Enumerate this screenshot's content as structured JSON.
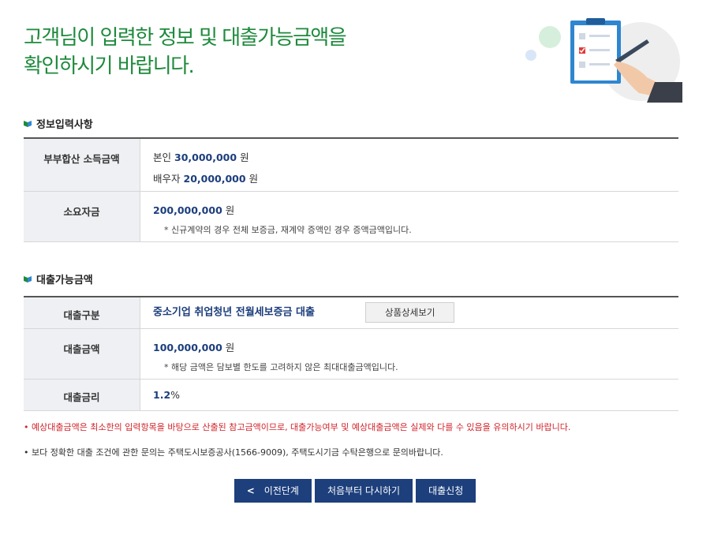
{
  "page": {
    "title_line1": "고객님이 입력한 정보 및 대출가능금액을",
    "title_line2": "확인하시기 바랍니다."
  },
  "colors": {
    "accent_green": "#1e8a3c",
    "navy": "#1d3f7c",
    "red": "#d0232a",
    "header_bg": "#eef0f3"
  },
  "input_section": {
    "heading": "정보입력사항",
    "heading_icon": "book-icon",
    "rows": {
      "income": {
        "label": "부부합산 소득금액",
        "self_label": "본인",
        "self_amount": "30,000,000",
        "self_unit": "원",
        "spouse_label": "배우자",
        "spouse_amount": "20,000,000",
        "spouse_unit": "원"
      },
      "required_funds": {
        "label": "소요자금",
        "amount": "200,000,000",
        "unit": "원",
        "note": "* 신규계약의 경우 전체 보증금, 재계약 증액인 경우 증액금액입니다."
      }
    }
  },
  "loan_section": {
    "heading": "대출가능금액",
    "heading_icon": "book-icon",
    "rows": {
      "type": {
        "label": "대출구분",
        "value": "중소기업 취업청년 전월세보증금 대출",
        "detail_button": "상품상세보기"
      },
      "amount": {
        "label": "대출금액",
        "value": "100,000,000",
        "unit": "원",
        "note": "* 해당 금액은 담보별 한도를 고려하지 않은 최대대출금액입니다."
      },
      "rate": {
        "label": "대출금리",
        "value": "1.2",
        "unit": "%"
      }
    }
  },
  "notices": [
    "• 예상대출금액은 최소한의 입력항목을 바탕으로 산출된 참고금액이므로, 대출가능여부 및 예상대출금액은 실제와 다를 수 있음을 유의하시기 바랍니다.",
    "• 보다 정확한 대출 조건에 관한 문의는 주택도시보증공사(1566-9009), 주택도시기금 수탁은행으로 문의바랍니다."
  ],
  "buttons": {
    "prev_chevron": "<",
    "prev": "이전단계",
    "restart": "처음부터 다시하기",
    "apply": "대출신청"
  }
}
